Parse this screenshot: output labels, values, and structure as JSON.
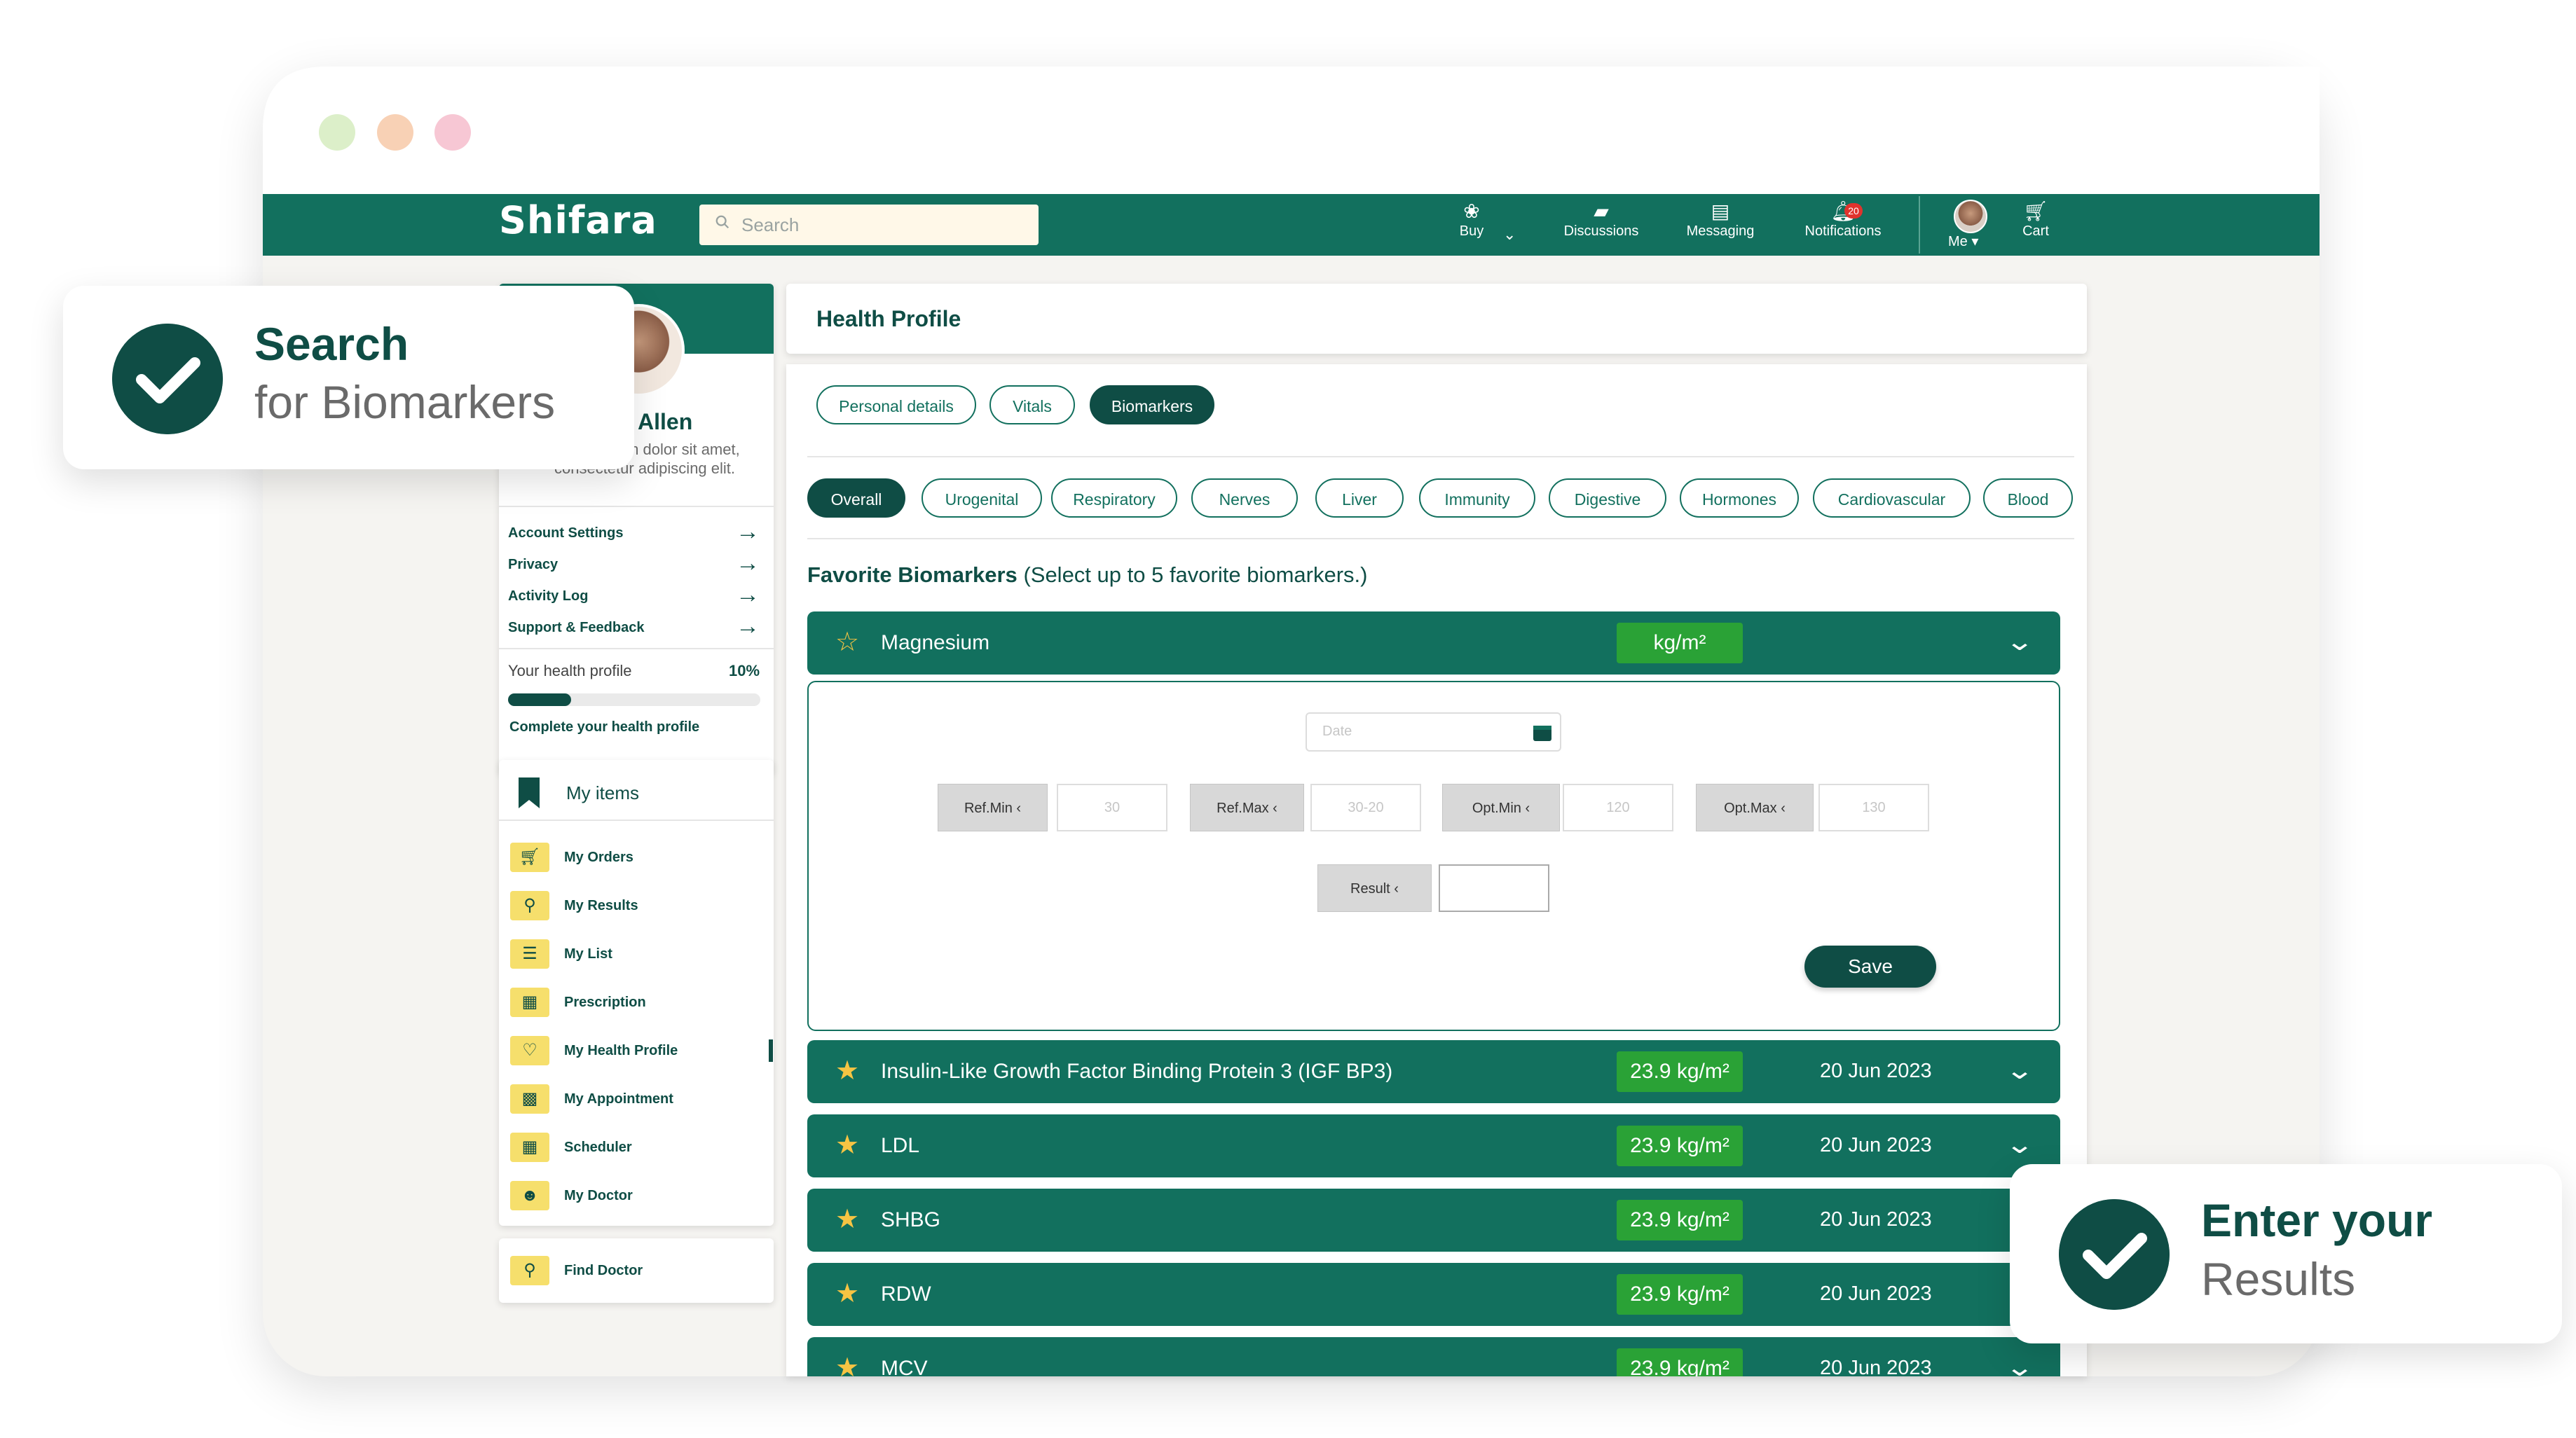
{
  "window": {
    "dots": [
      "#dcefc9",
      "#f8d1b5",
      "#f7c7d4"
    ]
  },
  "navbar": {
    "logo": "Shifara",
    "search_placeholder": "Search",
    "items": [
      {
        "label": "Buy",
        "icon": "buy-icon"
      },
      {
        "label": "Discussions",
        "icon": "discussions-icon"
      },
      {
        "label": "Messaging",
        "icon": "messaging-icon"
      },
      {
        "label": "Notifications",
        "icon": "notifications-icon",
        "badge": "20"
      },
      {
        "label": "Me",
        "icon": "avatar"
      },
      {
        "label": "Cart",
        "icon": "cart-icon"
      }
    ]
  },
  "profile": {
    "name": "Allen",
    "bio": "Lorem ipsum dolor sit amet, consectetur adipiscing elit.",
    "menu": [
      "Account Settings",
      "Privacy",
      "Activity Log",
      "Support & Feedback"
    ],
    "health_profile_label": "Your health profile",
    "health_profile_percent": "10%",
    "health_profile_progress": 0.1,
    "complete_link": "Complete your health profile"
  },
  "my_items": {
    "title": "My items",
    "items": [
      {
        "label": "My Orders",
        "icon": "cart-icon"
      },
      {
        "label": "My Results",
        "icon": "results-icon"
      },
      {
        "label": "My List",
        "icon": "list-icon"
      },
      {
        "label": "Prescription",
        "icon": "prescription-icon"
      },
      {
        "label": "My Health Profile",
        "icon": "health-profile-icon"
      },
      {
        "label": "My Appointment",
        "icon": "appointment-icon"
      },
      {
        "label": "Scheduler",
        "icon": "scheduler-icon"
      },
      {
        "label": "My Doctor",
        "icon": "doctor-icon"
      }
    ],
    "find_doctor": "Find Doctor"
  },
  "main": {
    "title": "Health Profile",
    "tabs": [
      "Personal details",
      "Vitals",
      "Biomarkers"
    ],
    "active_tab": "Biomarkers",
    "categories": [
      "Overall",
      "Urogenital",
      "Respiratory",
      "Nerves",
      "Liver",
      "Immunity",
      "Digestive",
      "Hormones",
      "Cardiovascular",
      "Blood"
    ],
    "active_category": "Overall",
    "favorites_heading": "Favorite Biomarkers",
    "favorites_hint": "(Select up to 5 favorite biomarkers.)",
    "expanded": {
      "name": "Magnesium",
      "unit": "kg/m²",
      "date_placeholder": "Date",
      "fields": [
        {
          "label": "Ref.Min ‹",
          "value": "30"
        },
        {
          "label": "Ref.Max ‹",
          "value": "30-20"
        },
        {
          "label": "Opt.Min ‹",
          "value": "120"
        },
        {
          "label": "Opt.Max ‹",
          "value": "130"
        }
      ],
      "result_label": "Result ‹",
      "result_value": "",
      "save": "Save"
    },
    "biomarkers": [
      {
        "name": "Insulin-Like Growth Factor Binding Protein 3 (IGF BP3)",
        "value": "23.9 kg/m²",
        "date": "20 Jun 2023"
      },
      {
        "name": "LDL",
        "value": "23.9 kg/m²",
        "date": "20 Jun 2023"
      },
      {
        "name": "SHBG",
        "value": "23.9 kg/m²",
        "date": "20 Jun 2023"
      },
      {
        "name": "RDW",
        "value": "23.9 kg/m²",
        "date": "20 Jun 2023"
      },
      {
        "name": "MCV",
        "value": "23.9 kg/m²",
        "date": "20 Jun 2023"
      }
    ]
  },
  "callouts": {
    "search": {
      "title": "Search",
      "subtitle": "for Biomarkers"
    },
    "enter": {
      "title": "Enter your",
      "subtitle": "Results"
    }
  },
  "colors": {
    "primary": "#12705e",
    "dark": "#0f4d45",
    "value_badge": "#2aa236",
    "star": "#f6c443",
    "item_icon_bg": "#f6df6c"
  }
}
